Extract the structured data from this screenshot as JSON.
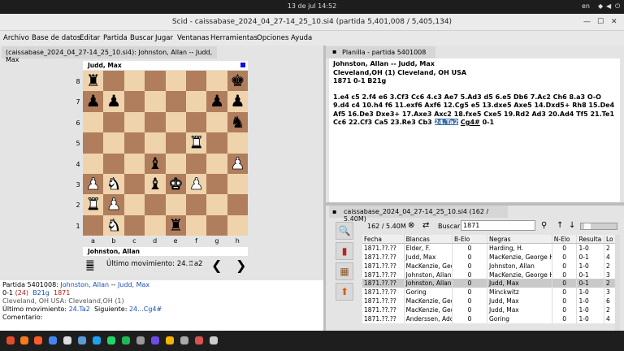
{
  "topbar": {
    "clock": "13 de jul  14:52",
    "lang": "en",
    "icons": [
      "network-icon",
      "sound-icon",
      "power-icon"
    ]
  },
  "window": {
    "title": "Scid - caissabase_2024_04_27-14_25_10.si4 (partida 5,401,008 / 5,405,134)"
  },
  "menu": [
    "Archivo",
    "Base de datos",
    "Editar",
    "Partida",
    "Buscar",
    "Jugar",
    "Ventanas",
    "Herramientas",
    "Opciones",
    "Ayuda"
  ],
  "board_tab": {
    "label": "(caissabase_2024_04_27-14_25_10.si4): Johnston, Allan -- Judd, Max"
  },
  "board": {
    "top_player": "Judd, Max",
    "bottom_player": "Johnston, Allan",
    "ranks": [
      "8",
      "7",
      "6",
      "5",
      "4",
      "3",
      "2",
      "1"
    ],
    "files": [
      "a",
      "b",
      "c",
      "d",
      "e",
      "f",
      "g",
      "h"
    ],
    "position": [
      [
        "bR",
        "",
        "",
        "",
        "",
        "",
        "",
        "bK"
      ],
      [
        "bP",
        "bP",
        "",
        "",
        "",
        "",
        "bP",
        "bP"
      ],
      [
        "",
        "",
        "",
        "",
        "",
        "",
        "",
        "bN"
      ],
      [
        "",
        "",
        "",
        "",
        "",
        "wR",
        "",
        ""
      ],
      [
        "",
        "",
        "",
        "bB",
        "",
        "",
        "",
        "wP"
      ],
      [
        "wP",
        "wN",
        "",
        "bB",
        "wK",
        "wP",
        "",
        ""
      ],
      [
        "wR",
        "wP",
        "",
        "",
        "",
        "",
        "",
        ""
      ],
      [
        "",
        "wN",
        "",
        "",
        "bR",
        "",
        "",
        ""
      ]
    ],
    "last_move_label": "Último movimiento: 24.♖a2",
    "prev": "❮",
    "next": "❯"
  },
  "info": {
    "game_label": "Partida 5401008:",
    "white": "Johnston, Allan",
    "sep": "--",
    "black": "Judd, Max",
    "result": "0-1",
    "moves_count": "(24)",
    "eco": "B21g",
    "year": "1871",
    "site": "Cleveland, OH USA:  Cleveland,OH (1)",
    "last_move_prefix": "Último movimiento:",
    "last_move": "24.Ta2",
    "next_prefix": "Siguiente:",
    "next_move": "24...Cg4#",
    "comment": "Comentario:"
  },
  "planilla": {
    "tab": "Planilla - partida 5401008",
    "line1": "Johnston, Allan   --   Judd, Max",
    "line2": "Cleveland,OH (1)  Cleveland, OH USA",
    "line3": "1871   0-1   B21g",
    "moves_a": "1.e4 c5 2.f4 e6 3.Cf3 Cc6 4.c3 Ae7 5.Ad3 d5 6.e5 Db6 7.Ac2 Ch6 8.a3 O-O 9.d4 c4 10.h4 f6 11.exf6 Axf6 12.Cg5 e5 13.dxe5 Axe5 14.Dxd5+ Rh8 15.De4 Af5 16.De3 Dxe3+ 17.Axe3 Axc2 18.fxe5 Cxe5 19.Rd2 Ad3 20.Ad4 Tf5 21.Te1 Cc6 22.Cf3 Ca5 23.Re3 Cb3",
    "current": "24.Ta2",
    "next": "Cg4#",
    "result": "0-1"
  },
  "gamelist": {
    "tab": "caissabase_2024_04_27-14_25_10.si4 (162 / 5.40M)",
    "count": "162 / 5.40M",
    "search_label": "Buscar",
    "search_value": "1871",
    "columns": [
      "Fecha",
      "Blancas",
      "B-Elo",
      "Negras",
      "N-Elo",
      "Resulta",
      "Lo"
    ],
    "rows": [
      [
        "1871.??.??",
        "Elder, F.",
        "0",
        "Harding, H.",
        "0",
        "1-0",
        "2"
      ],
      [
        "1871.??.??",
        "Judd, Max",
        "0",
        "MacKenzie, George H",
        "0",
        "0-1",
        "4"
      ],
      [
        "1871.??.??",
        "MacKenzie, George",
        "0",
        "Johnston, Allan",
        "0",
        "1-0",
        "2"
      ],
      [
        "1871.??.??",
        "Johnston, Allan",
        "0",
        "MacKenzie, George H",
        "0",
        "0-1",
        "3"
      ],
      [
        "1871.??.??",
        "Johnston, Allan",
        "0",
        "Judd, Max",
        "0",
        "0-1",
        "2"
      ],
      [
        "1871.??.??",
        "Goring",
        "0",
        "Minckwitz",
        "0",
        "1-0",
        "3"
      ],
      [
        "1871.??.??",
        "MacKenzie, George",
        "0",
        "Judd, Max",
        "0",
        "1-0",
        "6"
      ],
      [
        "1871.??.??",
        "MacKenzie, George",
        "0",
        "Judd, Max",
        "0",
        "1-0",
        "2"
      ],
      [
        "1871.??.??",
        "Anderssen, Adolf",
        "0",
        "Goring",
        "0",
        "1-0",
        "4"
      ]
    ],
    "selected_row": 4
  }
}
